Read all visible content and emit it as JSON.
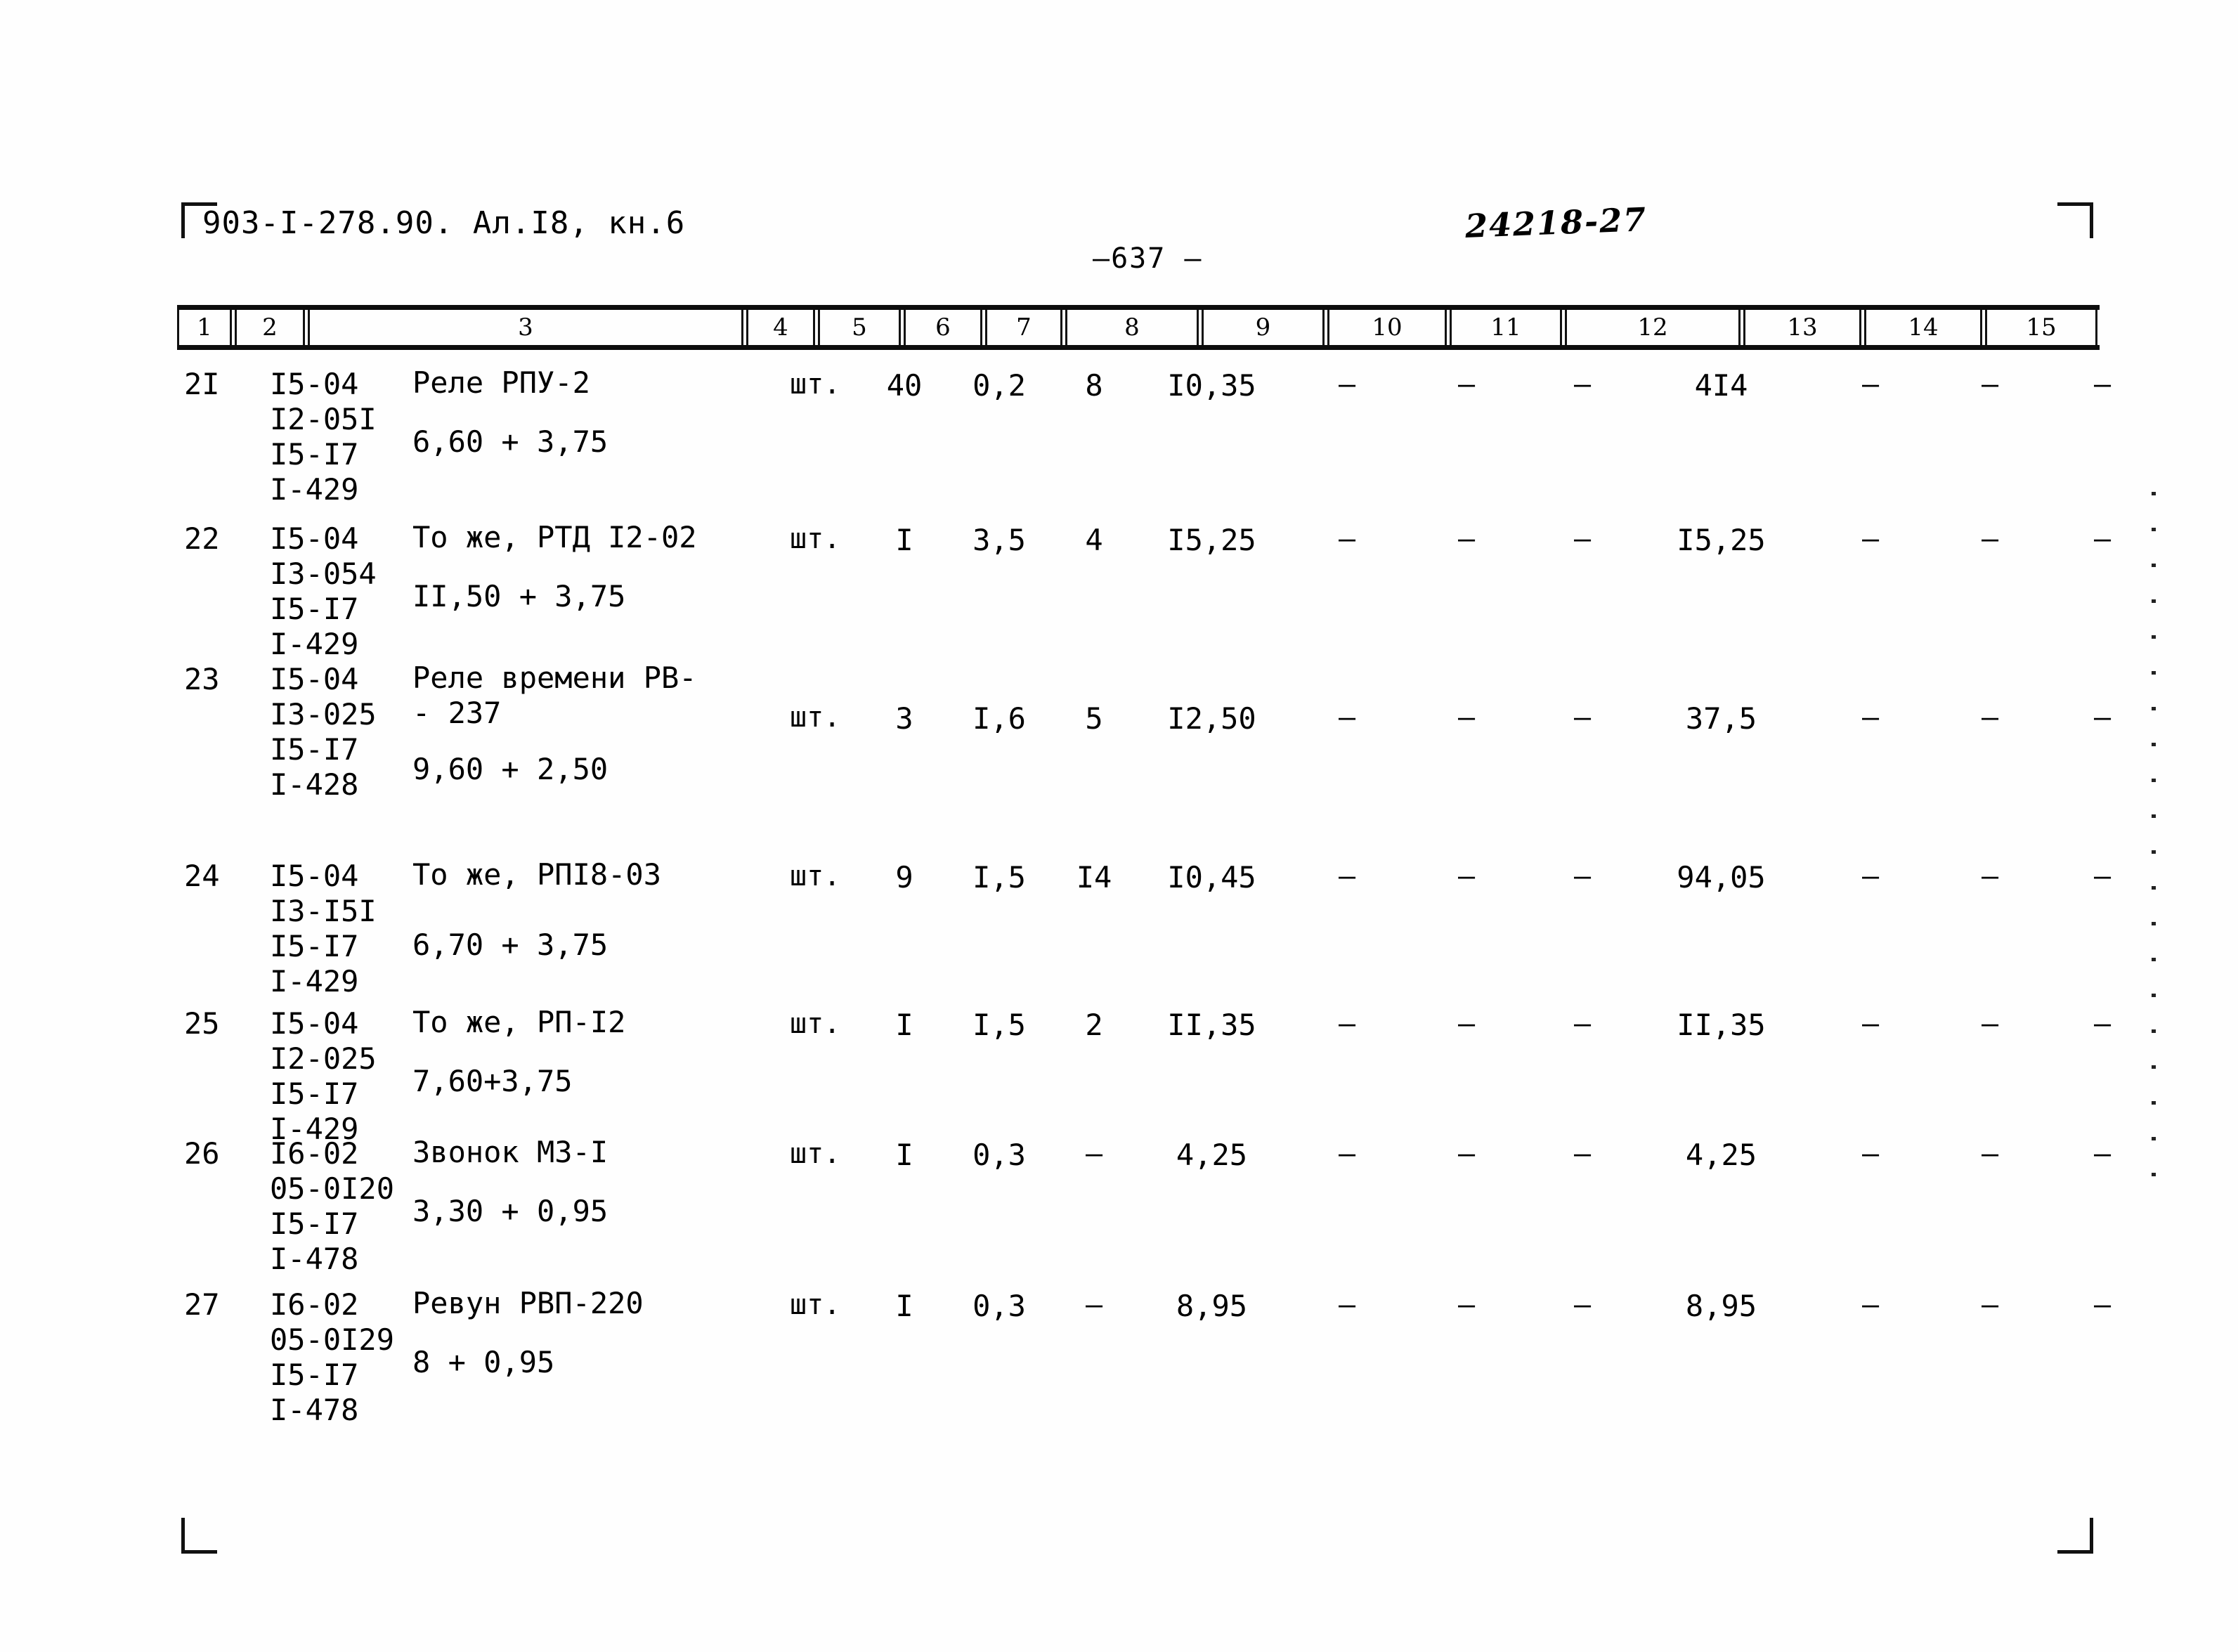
{
  "header": {
    "doc_code": "903-I-278.90.   Ал.I8, кн.6",
    "page_number": "—637 —",
    "stamp_number": "24218-27"
  },
  "table": {
    "column_numbers": [
      "1",
      "2",
      "3",
      "4",
      "5",
      "6",
      "7",
      "8",
      "9",
      "10",
      "11",
      "12",
      "13",
      "14",
      "15"
    ],
    "rows": [
      {
        "num": "2I",
        "codes": "I5-04\nI2-05I\nI5-I7\nI-429",
        "name": "Реле РПУ-2",
        "formula": "6,60 + 3,75",
        "unit": "шт.",
        "c5": "40",
        "c6": "0,2",
        "c7": "8",
        "c8": "I0,35",
        "c9": "—",
        "c10": "—",
        "c11": "—",
        "c12": "4I4",
        "c13": "—",
        "c14": "—",
        "c15": "—"
      },
      {
        "num": "22",
        "codes": "I5-04\nI3-054\nI5-I7\nI-429",
        "name": "То же, РТД I2-02",
        "formula": "II,50 + 3,75",
        "unit": "шт.",
        "c5": "I",
        "c6": "3,5",
        "c7": "4",
        "c8": "I5,25",
        "c9": "—",
        "c10": "—",
        "c11": "—",
        "c12": "I5,25",
        "c13": "—",
        "c14": "—",
        "c15": "—"
      },
      {
        "num": "23",
        "codes": "I5-04\nI3-025\nI5-I7\nI-428",
        "name": "Реле времени РВ-\n- 237",
        "formula": "9,60 + 2,50",
        "unit": "шт.",
        "c5": "3",
        "c6": "I,6",
        "c7": "5",
        "c8": "I2,50",
        "c9": "—",
        "c10": "—",
        "c11": "—",
        "c12": "37,5",
        "c13": "—",
        "c14": "—",
        "c15": "—"
      },
      {
        "num": "24",
        "codes": "I5-04\nI3-I5I\nI5-I7\nI-429",
        "name": "То же, РПI8-03",
        "formula": "6,70 + 3,75",
        "unit": "шт.",
        "c5": "9",
        "c6": "I,5",
        "c7": "I4",
        "c8": "I0,45",
        "c9": "—",
        "c10": "—",
        "c11": "—",
        "c12": "94,05",
        "c13": "—",
        "c14": "—",
        "c15": "—"
      },
      {
        "num": "25",
        "codes": "I5-04\nI2-025\nI5-I7\nI-429",
        "name": "То же, РП-I2",
        "formula": "7,60+3,75",
        "unit": "шт.",
        "c5": "I",
        "c6": "I,5",
        "c7": "2",
        "c8": "II,35",
        "c9": "—",
        "c10": "—",
        "c11": "—",
        "c12": "II,35",
        "c13": "—",
        "c14": "—",
        "c15": "—"
      },
      {
        "num": "26",
        "codes": "I6-02\n05-0I20\nI5-I7\nI-478",
        "name": "Звонок МЗ-I",
        "formula": "3,30 + 0,95",
        "unit": "шт.",
        "c5": "I",
        "c6": "0,3",
        "c7": "—",
        "c8": "4,25",
        "c9": "—",
        "c10": "—",
        "c11": "—",
        "c12": "4,25",
        "c13": "—",
        "c14": "—",
        "c15": "—"
      },
      {
        "num": "27",
        "codes": "I6-02\n05-0I29\nI5-I7\nI-478",
        "name": "Ревун РВП-220",
        "formula": "8 + 0,95",
        "unit": "шт.",
        "c5": "I",
        "c6": "0,3",
        "c7": "—",
        "c8": "8,95",
        "c9": "—",
        "c10": "—",
        "c11": "—",
        "c12": "8,95",
        "c13": "—",
        "c14": "—",
        "c15": "—"
      }
    ]
  }
}
